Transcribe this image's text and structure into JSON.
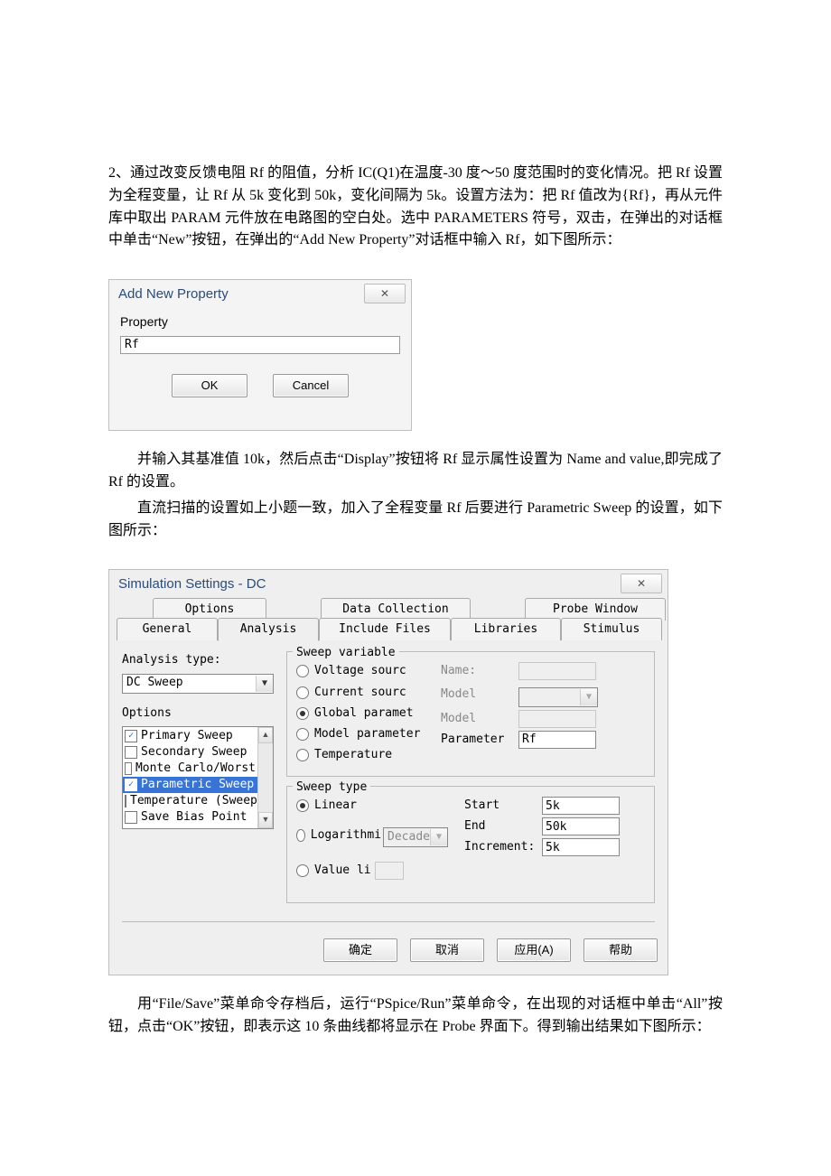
{
  "paras": {
    "p1": "2、通过改变反馈电阻 Rf 的阻值，分析 IC(Q1)在温度-30 度～50 度范围时的变化情况。把 Rf 设置为全程变量，让 Rf 从 5k 变化到 50k，变化间隔为 5k。设置方法为：把 Rf 值改为{Rf}，再从元件库中取出 PARAM 元件放在电路图的空白处。选中 PARAMETERS 符号，双击，在弹出的对话框中单击“New”按钮，在弹出的“Add New Property”对话框中输入 Rf，如下图所示：",
    "p2": "并输入其基准值 10k，然后点击“Display”按钮将 Rf 显示属性设置为 Name and value,即完成了 Rf 的设置。",
    "p3": "直流扫描的设置如上小题一致，加入了全程变量 Rf 后要进行 Parametric Sweep 的设置，如下图所示：",
    "p4": "用“File/Save”菜单命令存档后，运行“PSpice/Run”菜单命令，在出现的对话框中单击“All”按钮，点击“OK”按钮，即表示这 10 条曲线都将显示在 Probe 界面下。得到输出结果如下图所示："
  },
  "dlg1": {
    "title": "Add New Property",
    "label": "Property",
    "value": "Rf",
    "ok": "OK",
    "cancel": "Cancel"
  },
  "dlg2": {
    "title": "Simulation Settings - DC",
    "tabs_top": [
      "Options",
      "Data Collection",
      "Probe Window"
    ],
    "tabs_bot": [
      "General",
      "Analysis",
      "Include Files",
      "Libraries",
      "Stimulus"
    ],
    "analysis_type_lbl": "Analysis type:",
    "analysis_type_val": "DC Sweep",
    "options_lbl": "Options",
    "options_items": [
      {
        "label": "Primary Sweep",
        "checked": true,
        "selected": false
      },
      {
        "label": "Secondary Sweep",
        "checked": false,
        "selected": false
      },
      {
        "label": "Monte Carlo/Worst",
        "checked": false,
        "selected": false
      },
      {
        "label": "Parametric Sweep",
        "checked": true,
        "selected": true
      },
      {
        "label": "Temperature (Sweep",
        "checked": false,
        "selected": false
      },
      {
        "label": "Save Bias Point",
        "checked": false,
        "selected": false
      }
    ],
    "grp_sweepvar": "Sweep variable",
    "radios_var": [
      {
        "label": "Voltage sourc",
        "sel": false
      },
      {
        "label": "Current sourc",
        "sel": false
      },
      {
        "label": "Global paramet",
        "sel": true
      },
      {
        "label": "Model parameter",
        "sel": false
      },
      {
        "label": "Temperature",
        "sel": false
      }
    ],
    "var_fields": {
      "name": "Name:",
      "model1": "Model",
      "model2": "Model",
      "paramLbl": "Parameter",
      "paramVal": "Rf"
    },
    "grp_sweeptype": "Sweep type",
    "radios_type": [
      {
        "label": "Linear",
        "sel": true
      },
      {
        "label": "Logarithmi",
        "sel": false
      },
      {
        "label": "Value li",
        "sel": false
      }
    ],
    "log_scale": "Decade",
    "type_fields": {
      "start": "Start",
      "startv": "5k",
      "end": "End",
      "endv": "50k",
      "inc": "Increment:",
      "incv": "5k"
    },
    "buttons": {
      "ok": "确定",
      "cancel": "取消",
      "apply": "应用(A)",
      "help": "帮助"
    }
  }
}
